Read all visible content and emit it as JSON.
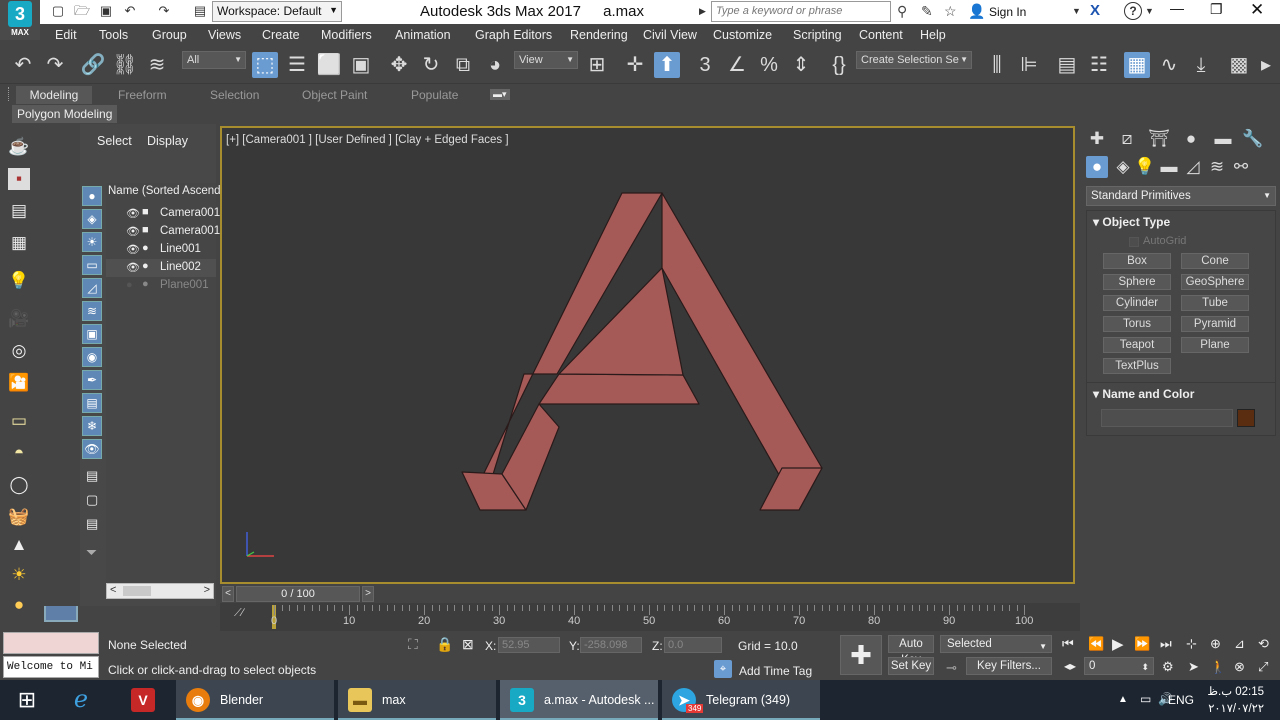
{
  "title_bar": {
    "logo_number": "3",
    "logo_text": "MAX",
    "workspace": "Workspace: Default",
    "app_title": "Autodesk 3ds Max 2017",
    "file_name": "a.max",
    "search_placeholder": "Type a keyword or phrase",
    "sign_in": "Sign In"
  },
  "menus": [
    "Edit",
    "Tools",
    "Group",
    "Views",
    "Create",
    "Modifiers",
    "Animation",
    "Graph Editors",
    "Rendering",
    "Civil View",
    "Customize",
    "Scripting",
    "Content",
    "Help"
  ],
  "main_toolbar": {
    "selection_filter": "All",
    "ref_coord": "View",
    "named_selection": "Create Selection Se"
  },
  "ribbon": {
    "tabs": [
      "Modeling",
      "Freeform",
      "Selection",
      "Object Paint",
      "Populate"
    ],
    "active_tab": "Modeling",
    "panel_label": "Polygon Modeling"
  },
  "scene_explorer": {
    "tabs": [
      "Select",
      "Display"
    ],
    "column_header": "Name (Sorted Ascend",
    "items": [
      {
        "name": "Camera001"
      },
      {
        "name": "Camera001"
      },
      {
        "name": "Line001"
      },
      {
        "name": "Line002"
      },
      {
        "name": "Plane001"
      }
    ]
  },
  "viewport": {
    "label": "[+] [Camera001 ] [User Defined ] [Clay + Edged Faces ]",
    "object_color": "#a65a58"
  },
  "timeline": {
    "frame_display": "0 / 100",
    "ticks": [
      "0",
      "10",
      "20",
      "30",
      "40",
      "50",
      "60",
      "70",
      "80",
      "90",
      "100"
    ]
  },
  "command_panel": {
    "category": "Standard Primitives",
    "object_type_title": "Object Type",
    "autogrid": "AutoGrid",
    "buttons": [
      "Box",
      "Cone",
      "Sphere",
      "GeoSphere",
      "Cylinder",
      "Tube",
      "Torus",
      "Pyramid",
      "Teapot",
      "Plane",
      "TextPlus"
    ],
    "name_color_title": "Name and Color",
    "swatch_color": "#5a2c10"
  },
  "status": {
    "maxscript_text": "Welcome to Mi",
    "selection": "None Selected",
    "prompt": "Click or click-and-drag to select objects",
    "x_label": "X:",
    "x_value": "52.95",
    "y_label": "Y:",
    "y_value": "-258.098",
    "z_label": "Z:",
    "z_value": "0.0",
    "grid": "Grid = 10.0",
    "add_time_tag": "Add Time Tag",
    "auto_key": "Auto Key",
    "set_key": "Set Key",
    "key_mode": "Selected",
    "key_filters": "Key Filters...",
    "current_frame": "0"
  },
  "taskbar": {
    "items": [
      {
        "label": "Blender"
      },
      {
        "label": "max"
      },
      {
        "label": "a.max - Autodesk ..."
      },
      {
        "label": "Telegram (349)"
      }
    ],
    "telegram_badge": "349",
    "lang": "ENG",
    "time": "02:15 ب.ظ",
    "date": "۲۰۱۷/۰۷/۲۲"
  }
}
